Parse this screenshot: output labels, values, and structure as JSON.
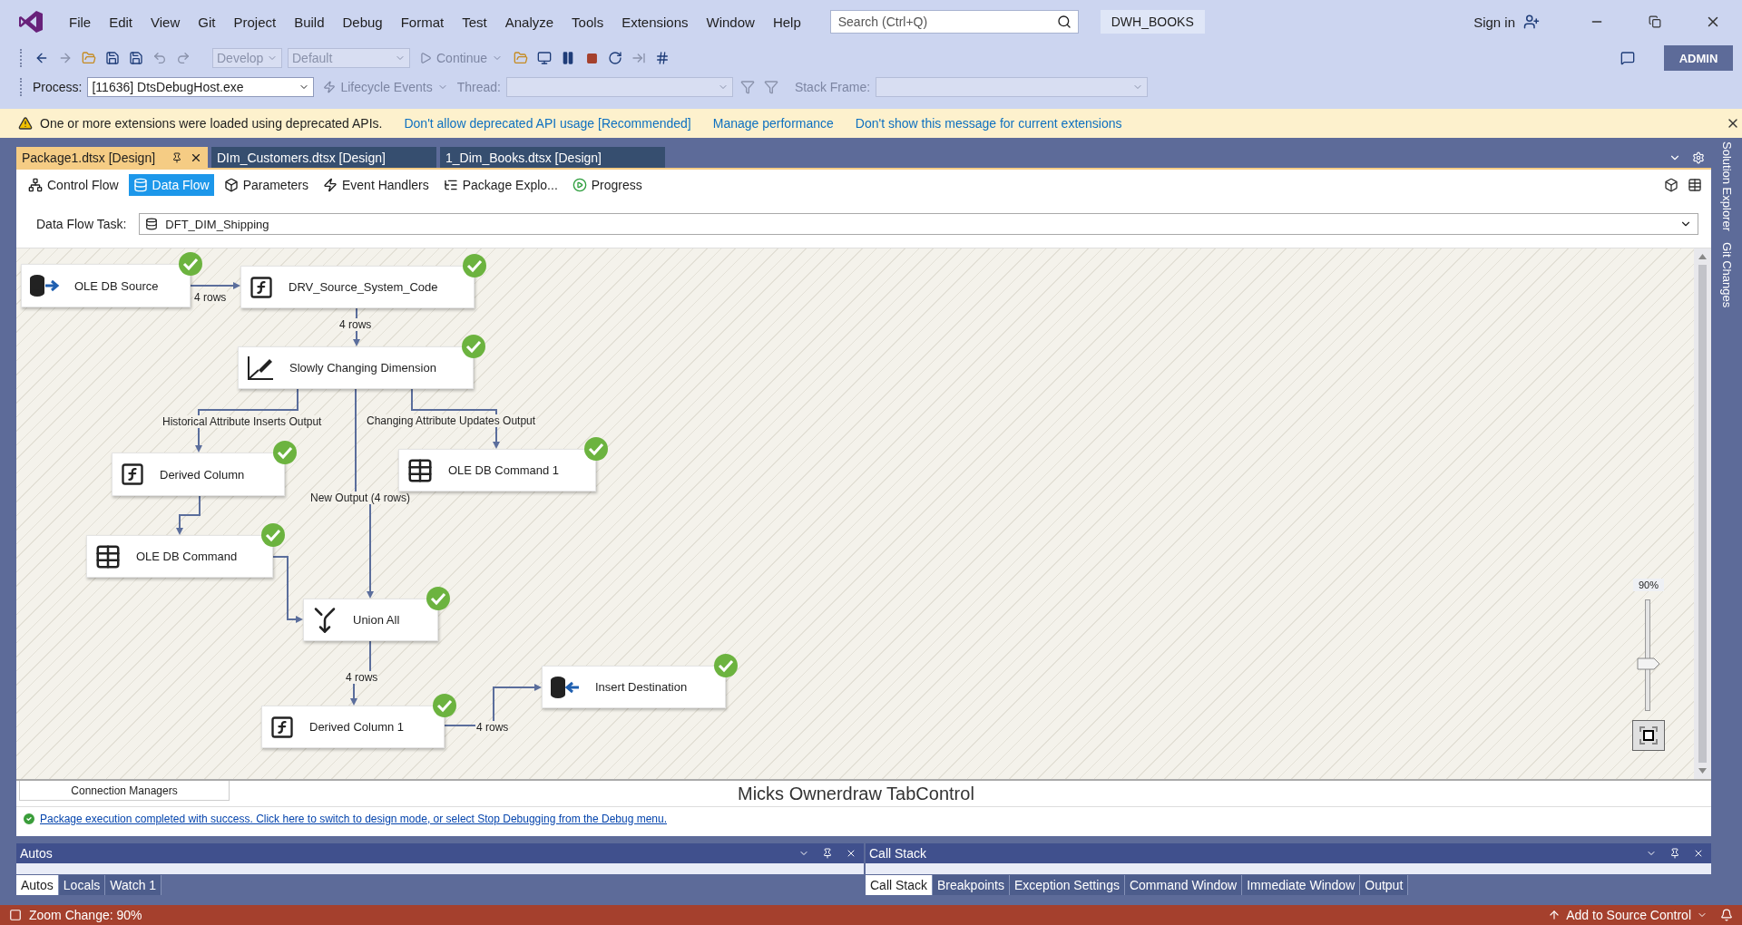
{
  "menu": [
    "File",
    "Edit",
    "View",
    "Git",
    "Project",
    "Build",
    "Debug",
    "Format",
    "Test",
    "Analyze",
    "Tools",
    "Extensions",
    "Window",
    "Help"
  ],
  "search": {
    "placeholder": "Search (Ctrl+Q)"
  },
  "solution_name": "DWH_BOOKS",
  "sign_in": "Sign in",
  "standard_toolbar": {
    "configuration": "Develop",
    "platform": "Default",
    "continue": "Continue",
    "account": "ADMIN"
  },
  "debug_location": {
    "process_label": "Process:",
    "process": "[11636] DtsDebugHost.exe",
    "lifecycle": "Lifecycle Events",
    "thread_label": "Thread:",
    "stack_frame_label": "Stack Frame:"
  },
  "info_bar": {
    "message": "One or more extensions were loaded using deprecated APIs.",
    "links": [
      "Don't allow deprecated API usage [Recommended]",
      "Manage performance",
      "Don't show this message for current extensions"
    ]
  },
  "document_tabs": [
    {
      "label": "Package1.dtsx [Design]",
      "selected": true
    },
    {
      "label": "DIm_Customers.dtsx [Design]",
      "selected": false
    },
    {
      "label": "1_Dim_Books.dtsx [Design]",
      "selected": false
    }
  ],
  "designer_tabs": [
    {
      "label": "Control Flow",
      "kind": "flow",
      "selected": false
    },
    {
      "label": "Data Flow",
      "kind": "data",
      "selected": true
    },
    {
      "label": "Parameters",
      "kind": "params",
      "selected": false
    },
    {
      "label": "Event Handlers",
      "kind": "events",
      "selected": false
    },
    {
      "label": "Package Explo...",
      "kind": "explorer",
      "selected": false
    },
    {
      "label": "Progress",
      "kind": "progress",
      "selected": false
    }
  ],
  "data_flow_task": {
    "label": "Data Flow Task:",
    "value": "DFT_DIM_Shipping"
  },
  "canvas": {
    "nodes": [
      {
        "label": "OLE DB Source",
        "kind": "source",
        "succeeded": true
      },
      {
        "label": "DRV_Source_System_Code",
        "kind": "derived",
        "succeeded": true
      },
      {
        "label": "Slowly Changing Dimension",
        "kind": "scd",
        "succeeded": true
      },
      {
        "label": "Derived Column",
        "kind": "derived",
        "succeeded": true
      },
      {
        "label": "OLE DB Command 1",
        "kind": "command",
        "succeeded": true
      },
      {
        "label": "OLE DB Command",
        "kind": "command",
        "succeeded": true
      },
      {
        "label": "Union All",
        "kind": "union",
        "succeeded": true
      },
      {
        "label": "Derived Column 1",
        "kind": "derived",
        "succeeded": true
      },
      {
        "label": "Insert Destination",
        "kind": "destination",
        "succeeded": true
      }
    ],
    "path_labels": [
      "4 rows",
      "4 rows",
      "Historical Attribute Inserts Output",
      "Changing Attribute Updates Output",
      "New Output (4 rows)",
      "4 rows",
      "4 rows"
    ],
    "zoom": {
      "reading": "90%",
      "level": 0.42
    }
  },
  "connection_managers_tab": "Connection Managers",
  "tab_control_caption": "Micks Ownerdraw TabControl",
  "execution_message": "Package execution completed with success. Click here to switch to design mode, or select Stop Debugging from the Debug menu.",
  "side_tabs": [
    "Solution Explorer",
    "Git Changes"
  ],
  "autos_panel": {
    "title": "Autos",
    "tabs": [
      {
        "label": "Autos",
        "selected": true
      },
      {
        "label": "Locals",
        "selected": false
      },
      {
        "label": "Watch 1",
        "selected": false
      }
    ]
  },
  "call_stack_panel": {
    "title": "Call Stack",
    "tabs": [
      {
        "label": "Call Stack",
        "selected": true
      },
      {
        "label": "Breakpoints",
        "selected": false
      },
      {
        "label": "Exception Settings",
        "selected": false
      },
      {
        "label": "Command Window",
        "selected": false
      },
      {
        "label": "Immediate Window",
        "selected": false
      },
      {
        "label": "Output",
        "selected": false
      }
    ]
  },
  "status_bar": {
    "message": "Zoom Change: 90%",
    "source_control": "Add to Source Control"
  }
}
